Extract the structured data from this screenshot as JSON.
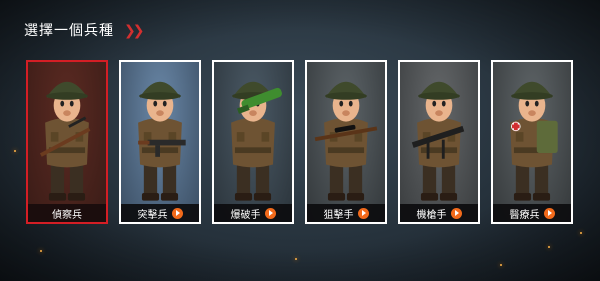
{
  "header": {
    "title": "選擇一個兵種",
    "chevrons": "»"
  },
  "classes": [
    {
      "label": "偵察兵",
      "selected": true,
      "weapon": "rifle",
      "bg": [
        "#5b2a22",
        "#3a1c17"
      ]
    },
    {
      "label": "突擊兵",
      "selected": false,
      "weapon": "smg",
      "bg": [
        "#6a88a8",
        "#3b4e63"
      ]
    },
    {
      "label": "爆破手",
      "selected": false,
      "weapon": "bazooka",
      "bg": [
        "#4b5a66",
        "#2b343b"
      ]
    },
    {
      "label": "狙擊手",
      "selected": false,
      "weapon": "sniper",
      "bg": [
        "#5d6468",
        "#33383b"
      ]
    },
    {
      "label": "機槍手",
      "selected": false,
      "weapon": "machinegun",
      "bg": [
        "#65686a",
        "#3a3d3f"
      ]
    },
    {
      "label": "醫療兵",
      "selected": false,
      "weapon": "medic",
      "bg": [
        "#5f6568",
        "#35393b"
      ]
    }
  ]
}
